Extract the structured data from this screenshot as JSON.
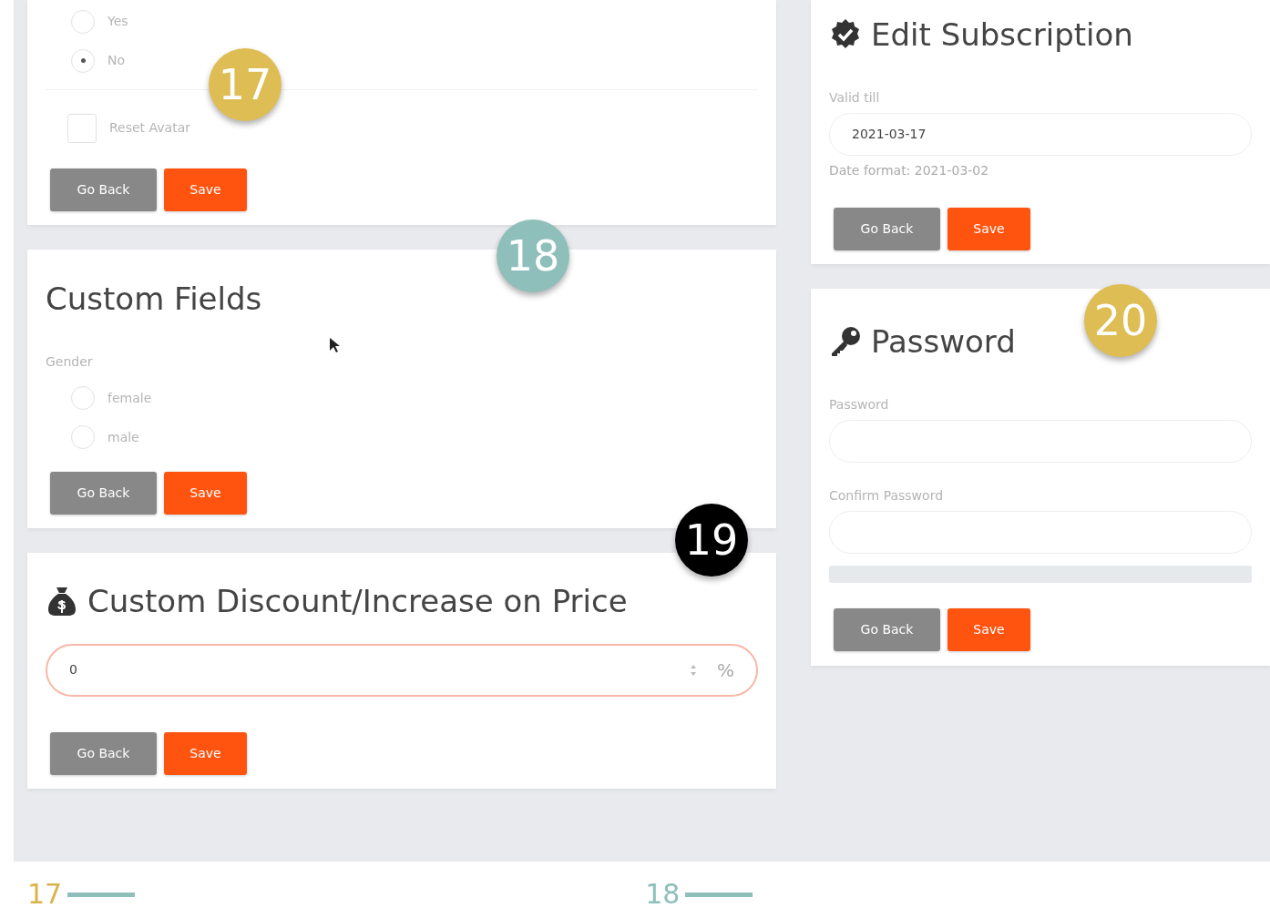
{
  "profile_card": {
    "options": [
      {
        "label": "Yes",
        "selected": false
      },
      {
        "label": "No",
        "selected": true
      }
    ],
    "reset_avatar": {
      "label": "Reset Avatar",
      "checked": false
    },
    "buttons": [
      {
        "label": "Go Back",
        "kind": "secondary"
      },
      {
        "label": "Save",
        "kind": "primary"
      }
    ]
  },
  "custom_fields": {
    "title": "Custom Fields",
    "field_label": "Gender",
    "options": [
      {
        "label": "female",
        "selected": false
      },
      {
        "label": "male",
        "selected": false
      }
    ],
    "buttons": [
      {
        "label": "Go Back",
        "kind": "secondary"
      },
      {
        "label": "Save",
        "kind": "primary"
      }
    ]
  },
  "custom_discount": {
    "title": "Custom Discount/Increase on Price",
    "value": "0",
    "unit": "%",
    "buttons": [
      {
        "label": "Go Back",
        "kind": "secondary"
      },
      {
        "label": "Save",
        "kind": "primary"
      }
    ]
  },
  "edit_subscription": {
    "title": "Edit Subscription",
    "field": {
      "label": "Valid till",
      "value": "2021-03-17",
      "help": "Date format: 2021-03-02"
    },
    "buttons": [
      {
        "label": "Go Back",
        "kind": "secondary"
      },
      {
        "label": "Save",
        "kind": "primary"
      }
    ]
  },
  "password": {
    "title": "Password",
    "fields": [
      {
        "label": "Password"
      },
      {
        "label": "Confirm Password"
      }
    ],
    "strength": {
      "level": 0
    },
    "buttons": [
      {
        "label": "Go Back",
        "kind": "secondary"
      },
      {
        "label": "Save",
        "kind": "primary"
      }
    ]
  },
  "annotations": [
    {
      "number": "17",
      "color": "#dfbd55"
    },
    {
      "number": "18",
      "color": "#8fbfba"
    },
    {
      "number": "19",
      "color": "#000000"
    },
    {
      "number": "20",
      "color": "#dfbd55"
    }
  ],
  "footer_labels": [
    {
      "number": "17",
      "color": "#d9b44a"
    },
    {
      "number": "18",
      "color": "#8fbfba"
    }
  ]
}
